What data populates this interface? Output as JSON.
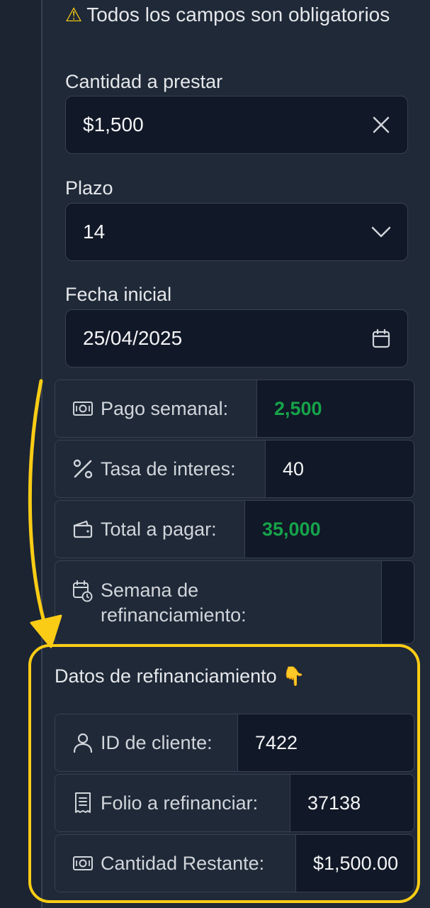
{
  "warning": {
    "icon": "warning-icon",
    "text": "Todos los campos son obligatorios"
  },
  "form": {
    "amount": {
      "label": "Cantidad a prestar",
      "value": "$1,500"
    },
    "term": {
      "label": "Plazo",
      "value": "14"
    },
    "start_date": {
      "label": "Fecha inicial",
      "value": "25/04/2025"
    }
  },
  "summary": [
    {
      "icon": "money-icon",
      "label": "Pago semanal:",
      "value": "2,500"
    },
    {
      "icon": "percent-icon",
      "label": "Tasa de interes:",
      "value": "40"
    },
    {
      "icon": "wallet-icon",
      "label": "Total a pagar:",
      "value": "35,000"
    },
    {
      "icon": "calendar-clock-icon",
      "label_line1": "Semana de",
      "label_line2": "refinanciamiento:",
      "value": ""
    }
  ],
  "refinance": {
    "title": "Datos de refinanciamiento",
    "title_emoji": "👇",
    "rows": [
      {
        "icon": "user-icon",
        "label": "ID de cliente:",
        "value": "7422"
      },
      {
        "icon": "receipt-icon",
        "label": "Folio a refinanciar:",
        "value": "37138"
      },
      {
        "icon": "money-icon",
        "label": "Cantidad Restante:",
        "value": "$1,500.00"
      }
    ]
  },
  "colors": {
    "accent_annotation": "#facc15",
    "positive": "#16a34a",
    "background": "#1f2937",
    "input_bg": "#111827"
  }
}
